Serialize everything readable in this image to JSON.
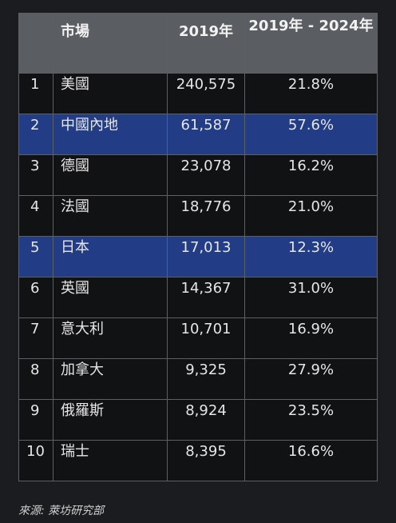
{
  "table": {
    "headers": [
      "",
      "市場",
      "2019年",
      "2019年 - 2024年"
    ],
    "rows": [
      {
        "rank": "1",
        "market": "美國",
        "value": "240,575",
        "growth": "21.8%",
        "highlight": false
      },
      {
        "rank": "2",
        "market": "中國內地",
        "value": "61,587",
        "growth": "57.6%",
        "highlight": true
      },
      {
        "rank": "3",
        "market": "德國",
        "value": "23,078",
        "growth": "16.2%",
        "highlight": false
      },
      {
        "rank": "4",
        "market": "法國",
        "value": "18,776",
        "growth": "21.0%",
        "highlight": false
      },
      {
        "rank": "5",
        "market": "日本",
        "value": "17,013",
        "growth": "12.3%",
        "highlight": true
      },
      {
        "rank": "6",
        "market": "英國",
        "value": "14,367",
        "growth": "31.0%",
        "highlight": false
      },
      {
        "rank": "7",
        "market": "意大利",
        "value": "10,701",
        "growth": "16.9%",
        "highlight": false
      },
      {
        "rank": "8",
        "market": "加拿大",
        "value": "9,325",
        "growth": "27.9%",
        "highlight": false
      },
      {
        "rank": "9",
        "market": "俄羅斯",
        "value": "8,924",
        "growth": "23.5%",
        "highlight": false
      },
      {
        "rank": "10",
        "market": "瑞士",
        "value": "8,395",
        "growth": "16.6%",
        "highlight": false
      }
    ]
  },
  "source": "來源: 萊坊研究部",
  "colors": {
    "background": "#1b1c1f",
    "header": "#5a5d61",
    "highlight": "#223d85",
    "row": "#111214"
  }
}
